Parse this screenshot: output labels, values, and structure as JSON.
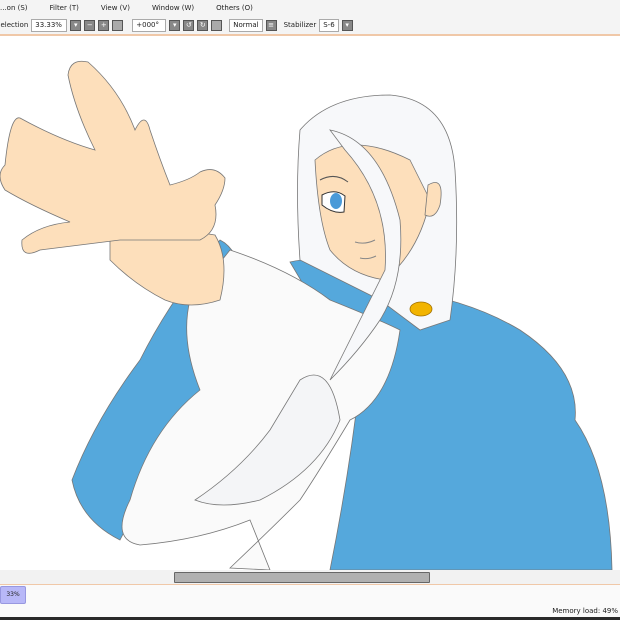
{
  "menu": [
    "...on (S)",
    "Filter (T)",
    "View (V)",
    "Window (W)",
    "Others (O)"
  ],
  "toolbar": {
    "selection_label": "Selection",
    "zoom_value": "33.33%",
    "rotation_value": "+000°",
    "blend_mode": "Normal",
    "stabilizer_label": "Stabilizer",
    "stabilizer_value": "S-6"
  },
  "status": {
    "zoom_tab": "33%",
    "memory_load": "Memory load: 49%"
  },
  "colors": {
    "skin": "#fddfbb",
    "cloak": "#55a8dc",
    "brooch": "#f2b400",
    "accent_border": "#f0c8a8"
  }
}
